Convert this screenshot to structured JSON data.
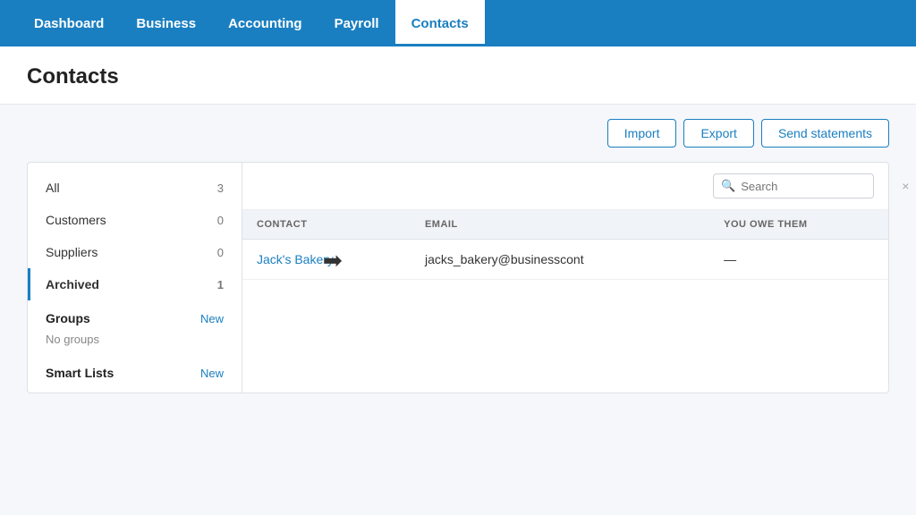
{
  "nav": {
    "items": [
      {
        "id": "dashboard",
        "label": "Dashboard",
        "active": false
      },
      {
        "id": "business",
        "label": "Business",
        "active": false
      },
      {
        "id": "accounting",
        "label": "Accounting",
        "active": false
      },
      {
        "id": "payroll",
        "label": "Payroll",
        "active": false
      },
      {
        "id": "contacts",
        "label": "Contacts",
        "active": true
      }
    ]
  },
  "page": {
    "title": "Contacts"
  },
  "toolbar": {
    "import_label": "Import",
    "export_label": "Export",
    "send_statements_label": "Send statements"
  },
  "sidebar": {
    "items": [
      {
        "id": "all",
        "label": "All",
        "count": "3",
        "new": null
      },
      {
        "id": "customers",
        "label": "Customers",
        "count": "0",
        "new": null
      },
      {
        "id": "suppliers",
        "label": "Suppliers",
        "count": "0",
        "new": null
      },
      {
        "id": "archived",
        "label": "Archived",
        "count": "1",
        "new": null
      }
    ],
    "groups_label": "Groups",
    "groups_new": "New",
    "no_groups_text": "No groups",
    "smart_lists_label": "Smart Lists",
    "smart_lists_new": "New"
  },
  "search": {
    "placeholder": "Search",
    "clear_label": "×"
  },
  "table": {
    "columns": [
      {
        "id": "contact",
        "label": "CONTACT"
      },
      {
        "id": "email",
        "label": "EMAIL"
      },
      {
        "id": "you_owe_them",
        "label": "YOU OWE THEM"
      }
    ],
    "rows": [
      {
        "contact": "Jack's Bakery",
        "email": "jacks_bakery@businesscont",
        "you_owe_them": "—"
      }
    ]
  }
}
